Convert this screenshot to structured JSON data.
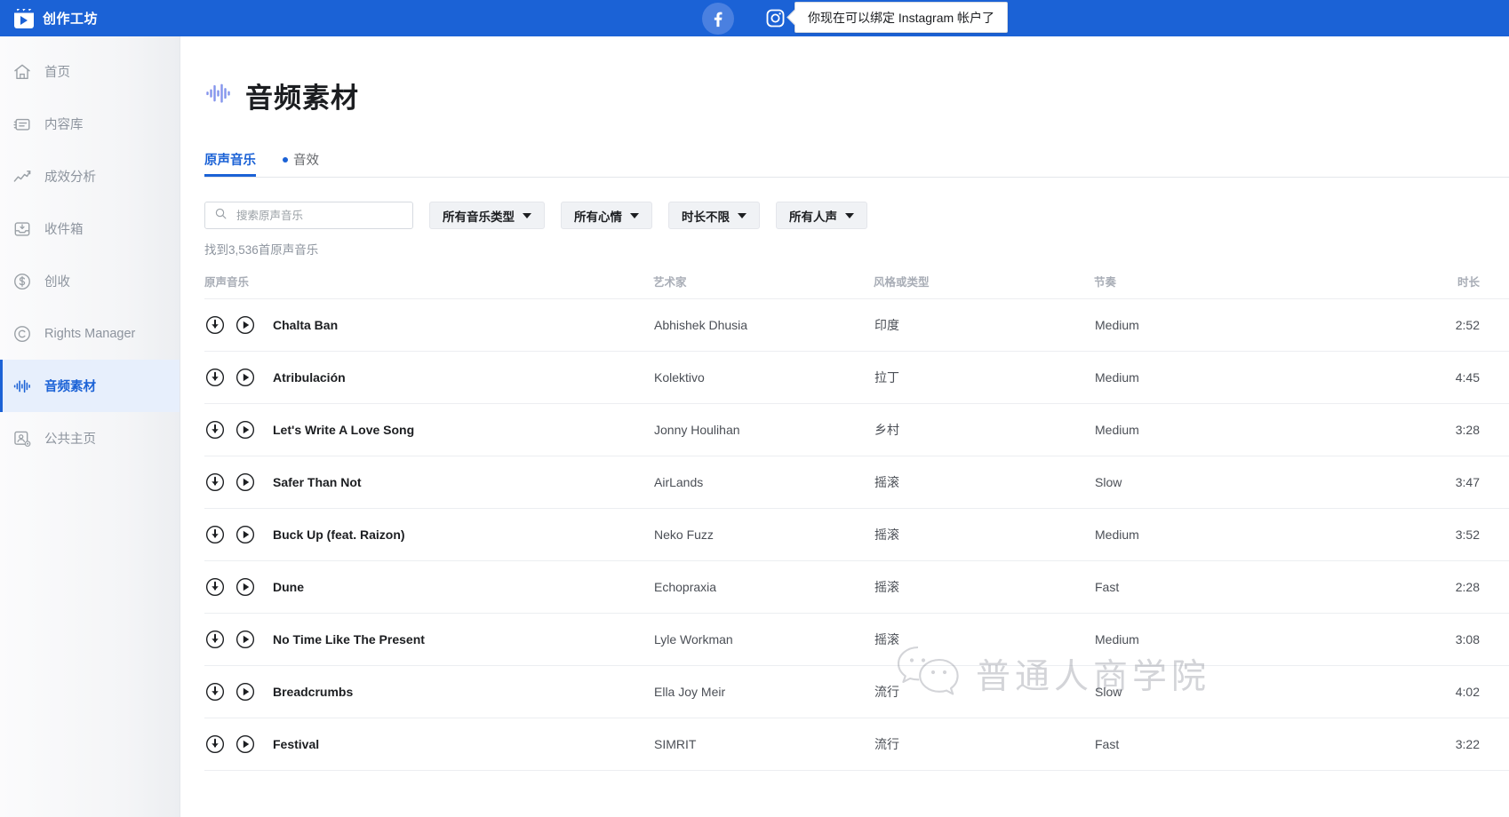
{
  "topbar": {
    "brand": "创作工坊",
    "brand_logo_icon": "video-clapper-icon",
    "facebook_icon": "facebook-icon",
    "instagram_icon": "instagram-icon",
    "tooltip": "你现在可以绑定 Instagram 帐户了",
    "bg_color": "#1b62d6"
  },
  "sidebar": {
    "items": [
      {
        "label": "首页",
        "icon": "home-icon",
        "active": false
      },
      {
        "label": "内容库",
        "icon": "content-library-icon",
        "active": false
      },
      {
        "label": "成效分析",
        "icon": "analytics-icon",
        "active": false
      },
      {
        "label": "收件箱",
        "icon": "inbox-icon",
        "active": false
      },
      {
        "label": "创收",
        "icon": "monetization-dollar-icon",
        "active": false
      },
      {
        "label": "Rights Manager",
        "icon": "copyright-icon",
        "active": false
      },
      {
        "label": "音频素材",
        "icon": "audio-waveform-icon",
        "active": true
      },
      {
        "label": "公共主页",
        "icon": "page-settings-icon",
        "active": false
      }
    ],
    "active_color": "#1b62d6"
  },
  "page": {
    "title": "音频素材",
    "title_icon": "audio-waveform-icon"
  },
  "tabs": [
    {
      "label": "原声音乐",
      "active": true,
      "dot": false
    },
    {
      "label": "音效",
      "active": false,
      "dot": true
    }
  ],
  "search": {
    "placeholder": "搜索原声音乐",
    "value": "",
    "icon": "search-icon"
  },
  "filters": [
    {
      "label": "所有音乐类型",
      "name": "music-type"
    },
    {
      "label": "所有心情",
      "name": "mood"
    },
    {
      "label": "时长不限",
      "name": "duration"
    },
    {
      "label": "所有人声",
      "name": "vocals"
    }
  ],
  "result_count": "找到3,536首原声音乐",
  "table": {
    "headers": [
      "原声音乐",
      "艺术家",
      "风格或类型",
      "节奏",
      "时长"
    ],
    "row_icons": {
      "download": "download-circle-icon",
      "play": "play-circle-icon"
    },
    "rows": [
      {
        "title": "Chalta Ban",
        "artist": "Abhishek Dhusia",
        "genre": "印度",
        "tempo": "Medium",
        "duration": "2:52"
      },
      {
        "title": "Atribulación",
        "artist": "Kolektivo",
        "genre": "拉丁",
        "tempo": "Medium",
        "duration": "4:45"
      },
      {
        "title": "Let's Write A Love Song",
        "artist": "Jonny Houlihan",
        "genre": "乡村",
        "tempo": "Medium",
        "duration": "3:28"
      },
      {
        "title": "Safer Than Not",
        "artist": "AirLands",
        "genre": "摇滚",
        "tempo": "Slow",
        "duration": "3:47"
      },
      {
        "title": "Buck Up (feat. Raizon)",
        "artist": "Neko Fuzz",
        "genre": "摇滚",
        "tempo": "Medium",
        "duration": "3:52"
      },
      {
        "title": "Dune",
        "artist": "Echopraxia",
        "genre": "摇滚",
        "tempo": "Fast",
        "duration": "2:28"
      },
      {
        "title": "No Time Like The Present",
        "artist": "Lyle Workman",
        "genre": "摇滚",
        "tempo": "Medium",
        "duration": "3:08"
      },
      {
        "title": "Breadcrumbs",
        "artist": "Ella Joy Meir",
        "genre": "流行",
        "tempo": "Slow",
        "duration": "4:02"
      },
      {
        "title": "Festival",
        "artist": "SIMRIT",
        "genre": "流行",
        "tempo": "Fast",
        "duration": "3:22"
      }
    ]
  },
  "watermark": {
    "text": "普通人商学院",
    "icon": "wechat-icon"
  }
}
